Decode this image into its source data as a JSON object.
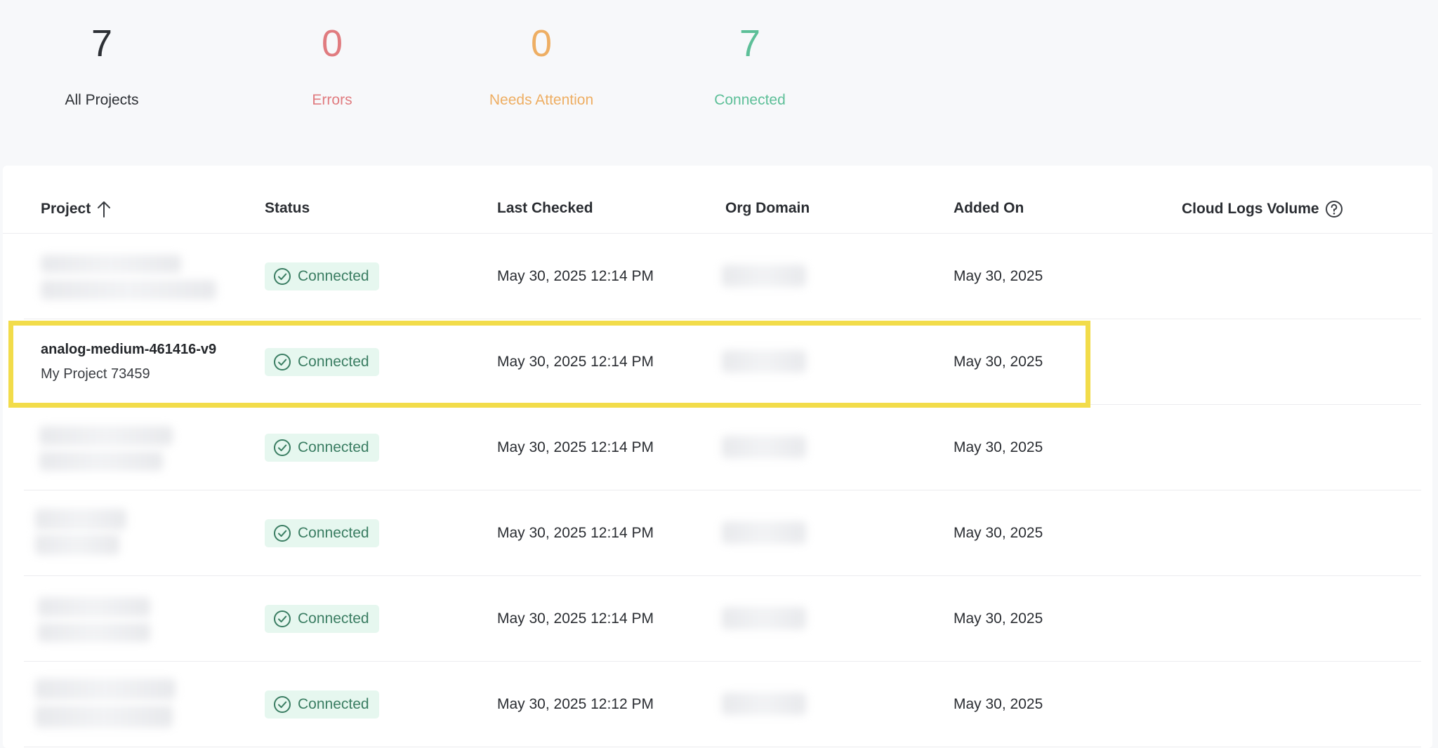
{
  "stats": {
    "all": {
      "value": "7",
      "label": "All Projects"
    },
    "errors": {
      "value": "0",
      "label": "Errors"
    },
    "attention": {
      "value": "0",
      "label": "Needs Attention"
    },
    "connected": {
      "value": "7",
      "label": "Connected"
    }
  },
  "colors": {
    "errors": "#e07b7f",
    "attention": "#eeae63",
    "connected": "#5dbf98",
    "highlight": "#f2dc4a",
    "badge_bg": "#e6f7ef"
  },
  "table": {
    "columns": {
      "project": "Project",
      "status": "Status",
      "last_checked": "Last Checked",
      "org_domain": "Org Domain",
      "added_on": "Added On",
      "cloud_logs_volume": "Cloud Logs Volume"
    },
    "sort_icon": "arrow-up-icon",
    "help_icon": "question-circle-icon",
    "rows": [
      {
        "project_name": "",
        "project_sub": "",
        "status": "Connected",
        "last_checked": "May 30, 2025 12:14 PM",
        "added_on": "May 30, 2025",
        "redacted": true
      },
      {
        "project_name": "analog-medium-461416-v9",
        "project_sub": "My Project 73459",
        "status": "Connected",
        "last_checked": "May 30, 2025 12:14 PM",
        "added_on": "May 30, 2025",
        "redacted": false
      },
      {
        "project_name": "",
        "project_sub": "",
        "status": "Connected",
        "last_checked": "May 30, 2025 12:14 PM",
        "added_on": "May 30, 2025",
        "redacted": true
      },
      {
        "project_name": "",
        "project_sub": "",
        "status": "Connected",
        "last_checked": "May 30, 2025 12:14 PM",
        "added_on": "May 30, 2025",
        "redacted": true
      },
      {
        "project_name": "",
        "project_sub": "",
        "status": "Connected",
        "last_checked": "May 30, 2025 12:14 PM",
        "added_on": "May 30, 2025",
        "redacted": true
      },
      {
        "project_name": "",
        "project_sub": "",
        "status": "Connected",
        "last_checked": "May 30, 2025 12:12 PM",
        "added_on": "May 30, 2025",
        "redacted": true
      }
    ]
  }
}
